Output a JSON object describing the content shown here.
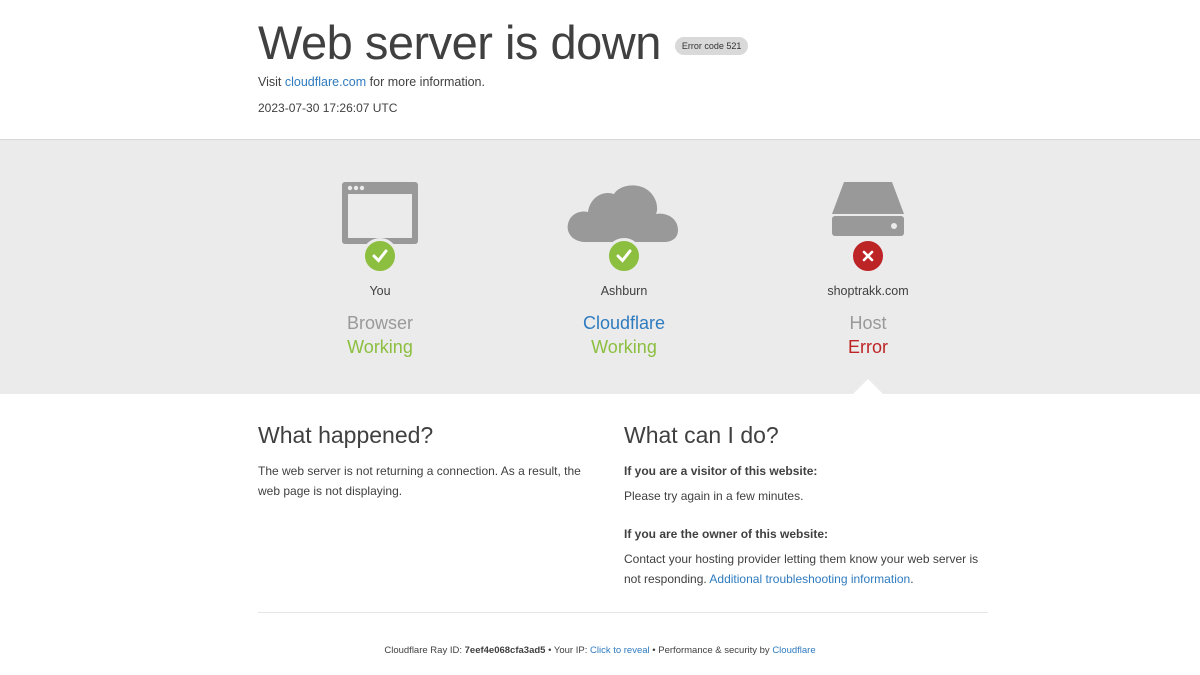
{
  "header": {
    "title": "Web server is down",
    "badge": "Error code 521",
    "visit_prefix": "Visit",
    "visit_link": "cloudflare.com",
    "visit_suffix": "for more information.",
    "timestamp": "2023-07-30 17:26:07 UTC"
  },
  "nodes": [
    {
      "location": "You",
      "kind": "Browser",
      "state": "Working",
      "status": "ok",
      "icon": "browser-icon"
    },
    {
      "location": "Ashburn",
      "kind": "Cloudflare",
      "state": "Working",
      "status": "ok",
      "icon": "cloud-icon"
    },
    {
      "location": "shoptrakk.com",
      "kind": "Host",
      "state": "Error",
      "status": "error",
      "icon": "server-icon"
    }
  ],
  "what_happened": {
    "heading": "What happened?",
    "body": "The web server is not returning a connection. As a result, the web page is not displaying."
  },
  "what_can_i_do": {
    "heading": "What can I do?",
    "visitor_label": "If you are a visitor of this website:",
    "visitor_text": "Please try again in a few minutes.",
    "owner_label": "If you are the owner of this website:",
    "owner_text": "Contact your hosting provider letting them know your web server is not responding.",
    "owner_link": "Additional troubleshooting information",
    "owner_end": "."
  },
  "footer": {
    "ray_label": "Cloudflare Ray ID:",
    "ray_id": "7eef4e068cfa3ad5",
    "sep1": "•",
    "ip_label": "Your IP:",
    "ip_link": "Click to reveal",
    "sep2": "•",
    "perf_label": "Performance & security by",
    "perf_link": "Cloudflare"
  },
  "colors": {
    "ok": "#8cbf3f",
    "error": "#bd2426",
    "link": "#2f7bbf",
    "band": "#ebebeb"
  }
}
